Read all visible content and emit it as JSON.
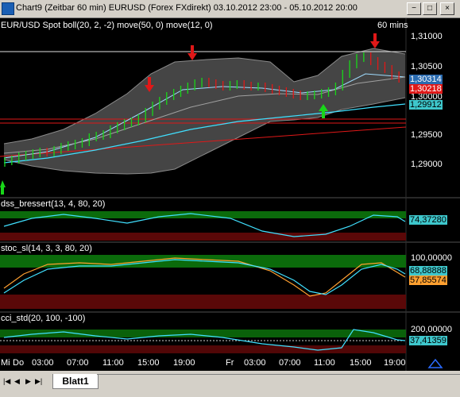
{
  "window": {
    "title": "Chart9 (Zeitbar 60 min)  EURUSD (Forex FXdirekt) 03.10.2012 23:00 - 05.10.2012 20:00",
    "buttons": [
      "−",
      "□",
      "×"
    ]
  },
  "chart": {
    "header_left": "EUR/USD Spot  boll(20, 2, -2) move(50, 0) move(12, 0)",
    "header_right": "60 mins",
    "price_axis": [
      "1,31000",
      "1,30500",
      "1,30000",
      "1,29500",
      "1,29000"
    ],
    "price_tags": [
      "1,30314",
      "1,30218",
      "1,29912"
    ],
    "panels": [
      {
        "label": "dss_bressert(13, 4, 80, 20)",
        "value": "74,37280"
      },
      {
        "label": "stoc_sl(14, 3, 3, 80, 20)",
        "axis": "100,00000",
        "value1": "68,88888",
        "value2": "57,85574"
      },
      {
        "label": "cci_std(20, 100, -100)",
        "axis": "200,00000",
        "value": "37,41359"
      }
    ],
    "time_axis": [
      "Mi",
      "Do",
      "03:00",
      "07:00",
      "11:00",
      "15:00",
      "19:00",
      "Fr",
      "03:00",
      "07:00",
      "11:00",
      "15:00",
      "19:00"
    ]
  },
  "tabs": {
    "sheet": "Blatt1"
  },
  "colors": {
    "background": "#000000",
    "bullish": "#19d619",
    "bearish": "#e01818",
    "bollinger_fill": "#5a5a5a",
    "ma_line": "#40e0ff",
    "overbought": "#0b6b0b",
    "oversold": "#5a0808"
  }
}
